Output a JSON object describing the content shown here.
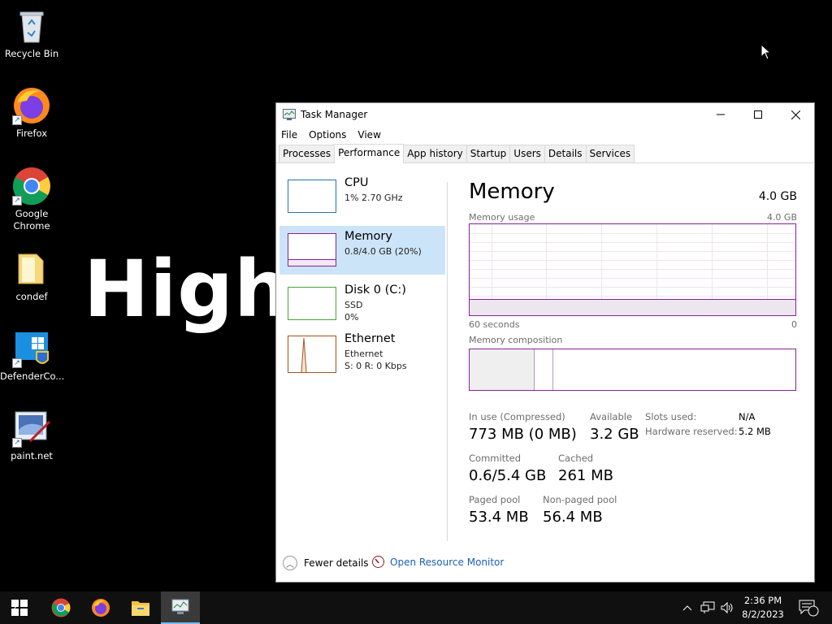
{
  "desktop": {
    "icons": [
      {
        "label": "Recycle Bin"
      },
      {
        "label": "Firefox"
      },
      {
        "label": "Google Chrome"
      },
      {
        "label": "condef"
      },
      {
        "label": "DefenderCo..."
      },
      {
        "label": "paint.net"
      }
    ],
    "wallpaper_text": "High"
  },
  "task_manager": {
    "title": "Task Manager",
    "menu": [
      "File",
      "Options",
      "View"
    ],
    "tabs": [
      "Processes",
      "Performance",
      "App history",
      "Startup",
      "Users",
      "Details",
      "Services"
    ],
    "active_tab": "Performance",
    "sidebar": [
      {
        "name": "CPU",
        "line1": "1%  2.70 GHz",
        "color": "#1f77b4"
      },
      {
        "name": "Memory",
        "line1": "0.8/4.0 GB (20%)",
        "color": "#8b1f9c"
      },
      {
        "name": "Disk 0 (C:)",
        "line1": "SSD",
        "line2": "0%",
        "color": "#4da035"
      },
      {
        "name": "Ethernet",
        "line1": "Ethernet",
        "line2": "S: 0  R: 0 Kbps",
        "color": "#a7521b"
      }
    ],
    "memory": {
      "heading": "Memory",
      "total": "4.0 GB",
      "usage_label": "Memory usage",
      "usage_max": "4.0 GB",
      "time_left": "60 seconds",
      "time_right": "0",
      "composition_label": "Memory composition",
      "usage_fraction": 0.2,
      "stats": {
        "in_use_label": "In use (Compressed)",
        "in_use_value": "773 MB (0 MB)",
        "available_label": "Available",
        "available_value": "3.2 GB",
        "committed_label": "Committed",
        "committed_value": "0.6/5.4 GB",
        "cached_label": "Cached",
        "cached_value": "261 MB",
        "paged_label": "Paged pool",
        "paged_value": "53.4 MB",
        "nonpaged_label": "Non-paged pool",
        "nonpaged_value": "56.4 MB",
        "slots_label": "Slots used:",
        "slots_value": "N/A",
        "hw_label": "Hardware reserved:",
        "hw_value": "5.2 MB"
      }
    },
    "footer": {
      "fewer_details": "Fewer details",
      "open_resource_monitor": "Open Resource Monitor"
    }
  },
  "taskbar": {
    "time": "2:36 PM",
    "date": "8/2/2023",
    "notification_count": "2",
    "apps": [
      "start-icon",
      "chrome-icon",
      "firefox-icon",
      "file-explorer-icon",
      "task-manager-icon"
    ]
  }
}
